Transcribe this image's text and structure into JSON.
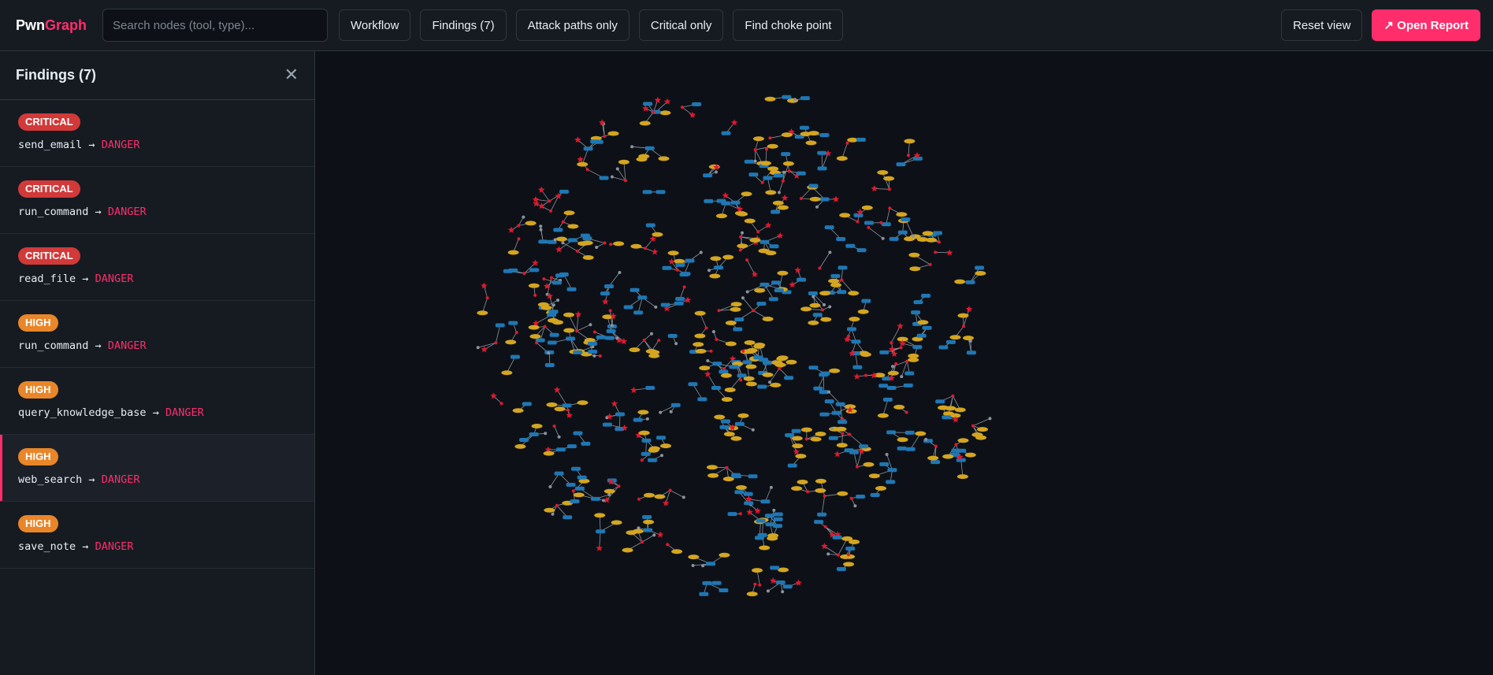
{
  "header": {
    "brand_part1": "Pwn",
    "brand_part2": "Graph",
    "search_placeholder": "Search nodes (tool, type)...",
    "buttons": [
      "Workflow",
      "Findings (7)",
      "Attack paths only",
      "Critical only",
      "Find choke point"
    ],
    "reset_label": "Reset view",
    "report_label": "↗ Open Report"
  },
  "sidebar": {
    "title": "Findings (7)",
    "close_glyph": "✕",
    "findings": [
      {
        "severity": "CRITICAL",
        "tool": "send_email",
        "arrow": "→",
        "result": "DANGER"
      },
      {
        "severity": "CRITICAL",
        "tool": "run_command",
        "arrow": "→",
        "result": "DANGER"
      },
      {
        "severity": "CRITICAL",
        "tool": "read_file",
        "arrow": "→",
        "result": "DANGER"
      },
      {
        "severity": "HIGH",
        "tool": "run_command",
        "arrow": "→",
        "result": "DANGER"
      },
      {
        "severity": "HIGH",
        "tool": "query_knowledge_base",
        "arrow": "→",
        "result": "DANGER"
      },
      {
        "severity": "HIGH",
        "tool": "web_search",
        "arrow": "→",
        "result": "DANGER"
      },
      {
        "severity": "HIGH",
        "tool": "save_note",
        "arrow": "→",
        "result": "DANGER"
      }
    ]
  },
  "colors": {
    "accent": "#ff2d6b",
    "critical": "#d23939",
    "high": "#e9862a",
    "tool_node": "#d4a520",
    "agent_node": "#1f77b4",
    "danger_node": "#e0192f",
    "edge": "#8b949e"
  }
}
